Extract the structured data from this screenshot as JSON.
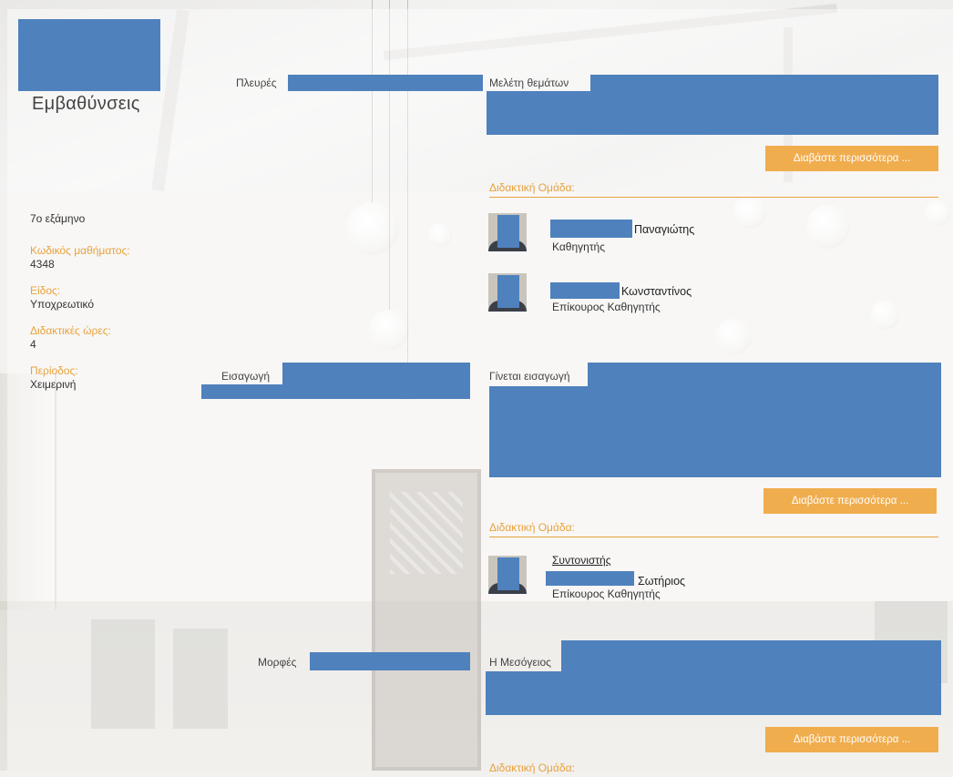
{
  "course": {
    "title": "Εμβαθύνσεις",
    "semester": "7ο εξάμηνο",
    "fields": [
      {
        "label": "Κωδικός μαθήματος:",
        "value": "4348"
      },
      {
        "label": "Είδος:",
        "value": "Υποχρεωτικό"
      },
      {
        "label": "Διδακτικές ώρες:",
        "value": "4"
      },
      {
        "label": "Περίοδος:",
        "value": "Χειμερινή"
      }
    ]
  },
  "sections": [
    {
      "title_prefix": "Πλευρές",
      "description_prefix": "Μελέτη   θεμάτων",
      "read_more": "Διαβάστε περισσότερα ...",
      "team_heading": "Διδακτική Ομάδα:",
      "members": [
        {
          "first_name": "Παναγιώτης",
          "role": "Καθηγητής"
        },
        {
          "first_name": "Κωνσταντίνος",
          "role": "Επίκουρος Καθηγητής"
        }
      ]
    },
    {
      "title_prefix": "Εισαγωγή",
      "description_prefix": "Γίνεται εισαγωγή",
      "read_more": "Διαβάστε περισσότερα ...",
      "team_heading": "Διδακτική Ομάδα:",
      "coordinator_label": "Συντονιστής",
      "members": [
        {
          "first_name": "Σωτήριος",
          "role": "Επίκουρος Καθηγητής"
        }
      ]
    },
    {
      "title_prefix": "Μορφές",
      "description_prefix": "Η Μεσόγειος",
      "read_more": "Διαβάστε περισσότερα ...",
      "team_heading": "Διδακτική Ομάδα:"
    }
  ],
  "colors": {
    "accent": "#f0ad4e",
    "label": "#e8a23c",
    "redaction": "#4f81bd"
  }
}
